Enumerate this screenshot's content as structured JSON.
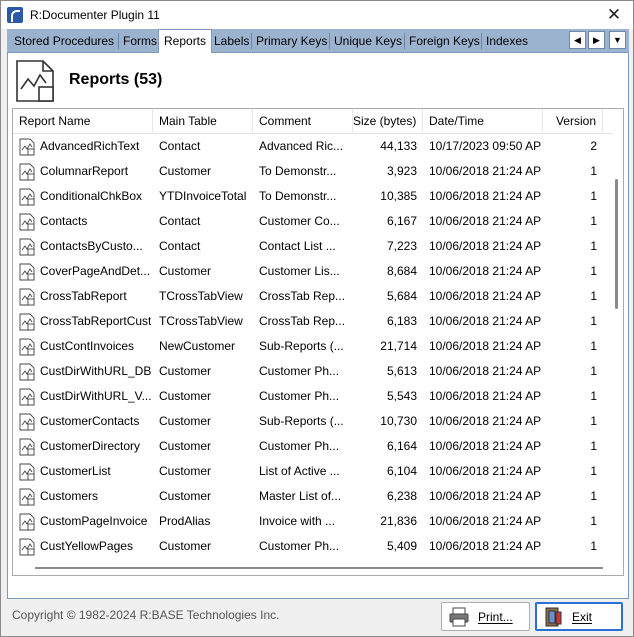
{
  "window": {
    "title": "R:Documenter Plugin 11"
  },
  "tabs": [
    "Stored Procedures",
    "Forms",
    "Reports",
    "Labels",
    "Primary Keys",
    "Unique Keys",
    "Foreign Keys",
    "Indexes"
  ],
  "active_tab": "Reports",
  "section": {
    "title": "Reports (53)"
  },
  "columns": [
    "Report Name",
    "Main Table",
    "Comment",
    "Size (bytes)",
    "Date/Time",
    "Version"
  ],
  "rows": [
    {
      "name": "AdvancedRichText",
      "table": "Contact",
      "comment": "Advanced Ric...",
      "size": "44,133",
      "date": "10/17/2023 09:50 AP",
      "version": "2"
    },
    {
      "name": "ColumnarReport",
      "table": "Customer",
      "comment": "To Demonstr...",
      "size": "3,923",
      "date": "10/06/2018 21:24 AP",
      "version": "1"
    },
    {
      "name": "ConditionalChkBox",
      "table": "YTDInvoiceTotal",
      "comment": "To Demonstr...",
      "size": "10,385",
      "date": "10/06/2018 21:24 AP",
      "version": "1"
    },
    {
      "name": "Contacts",
      "table": "Contact",
      "comment": "Customer Co...",
      "size": "6,167",
      "date": "10/06/2018 21:24 AP",
      "version": "1"
    },
    {
      "name": "ContactsByCusto...",
      "table": "Contact",
      "comment": "Contact List ...",
      "size": "7,223",
      "date": "10/06/2018 21:24 AP",
      "version": "1"
    },
    {
      "name": "CoverPageAndDet...",
      "table": "Customer",
      "comment": "Customer Lis...",
      "size": "8,684",
      "date": "10/06/2018 21:24 AP",
      "version": "1"
    },
    {
      "name": "CrossTabReport",
      "table": "TCrossTabView",
      "comment": "CrossTab Rep...",
      "size": "5,684",
      "date": "10/06/2018 21:24 AP",
      "version": "1"
    },
    {
      "name": "CrossTabReportCust",
      "table": "TCrossTabView",
      "comment": "CrossTab Rep...",
      "size": "6,183",
      "date": "10/06/2018 21:24 AP",
      "version": "1"
    },
    {
      "name": "CustContInvoices",
      "table": "NewCustomer",
      "comment": "Sub-Reports (...",
      "size": "21,714",
      "date": "10/06/2018 21:24 AP",
      "version": "1"
    },
    {
      "name": "CustDirWithURL_DB",
      "table": "Customer",
      "comment": "Customer Ph...",
      "size": "5,613",
      "date": "10/06/2018 21:24 AP",
      "version": "1"
    },
    {
      "name": "CustDirWithURL_V...",
      "table": "Customer",
      "comment": "Customer Ph...",
      "size": "5,543",
      "date": "10/06/2018 21:24 AP",
      "version": "1"
    },
    {
      "name": "CustomerContacts",
      "table": "Customer",
      "comment": "Sub-Reports (...",
      "size": "10,730",
      "date": "10/06/2018 21:24 AP",
      "version": "1"
    },
    {
      "name": "CustomerDirectory",
      "table": "Customer",
      "comment": "Customer Ph...",
      "size": "6,164",
      "date": "10/06/2018 21:24 AP",
      "version": "1"
    },
    {
      "name": "CustomerList",
      "table": "Customer",
      "comment": "List of Active ...",
      "size": "6,104",
      "date": "10/06/2018 21:24 AP",
      "version": "1"
    },
    {
      "name": "Customers",
      "table": "Customer",
      "comment": "Master List of...",
      "size": "6,238",
      "date": "10/06/2018 21:24 AP",
      "version": "1"
    },
    {
      "name": "CustomPageInvoice",
      "table": "ProdAlias",
      "comment": "Invoice with ...",
      "size": "21,836",
      "date": "10/06/2018 21:24 AP",
      "version": "1"
    },
    {
      "name": "CustYellowPages",
      "table": "Customer",
      "comment": "Customer Ph...",
      "size": "5,409",
      "date": "10/06/2018 21:24 AP",
      "version": "1"
    }
  ],
  "footer": {
    "copyright": "Copyright © 1982-2024 R:BASE Technologies Inc.",
    "print_label": "Print...",
    "exit_label": "Exit"
  },
  "icons": {
    "app": "rbase-app-icon",
    "report": "report-chart-icon",
    "print": "printer-icon",
    "exit": "exit-door-icon"
  },
  "colors": {
    "tab_bar": "#9bb3cf",
    "exit_border": "#2a6fd6"
  }
}
